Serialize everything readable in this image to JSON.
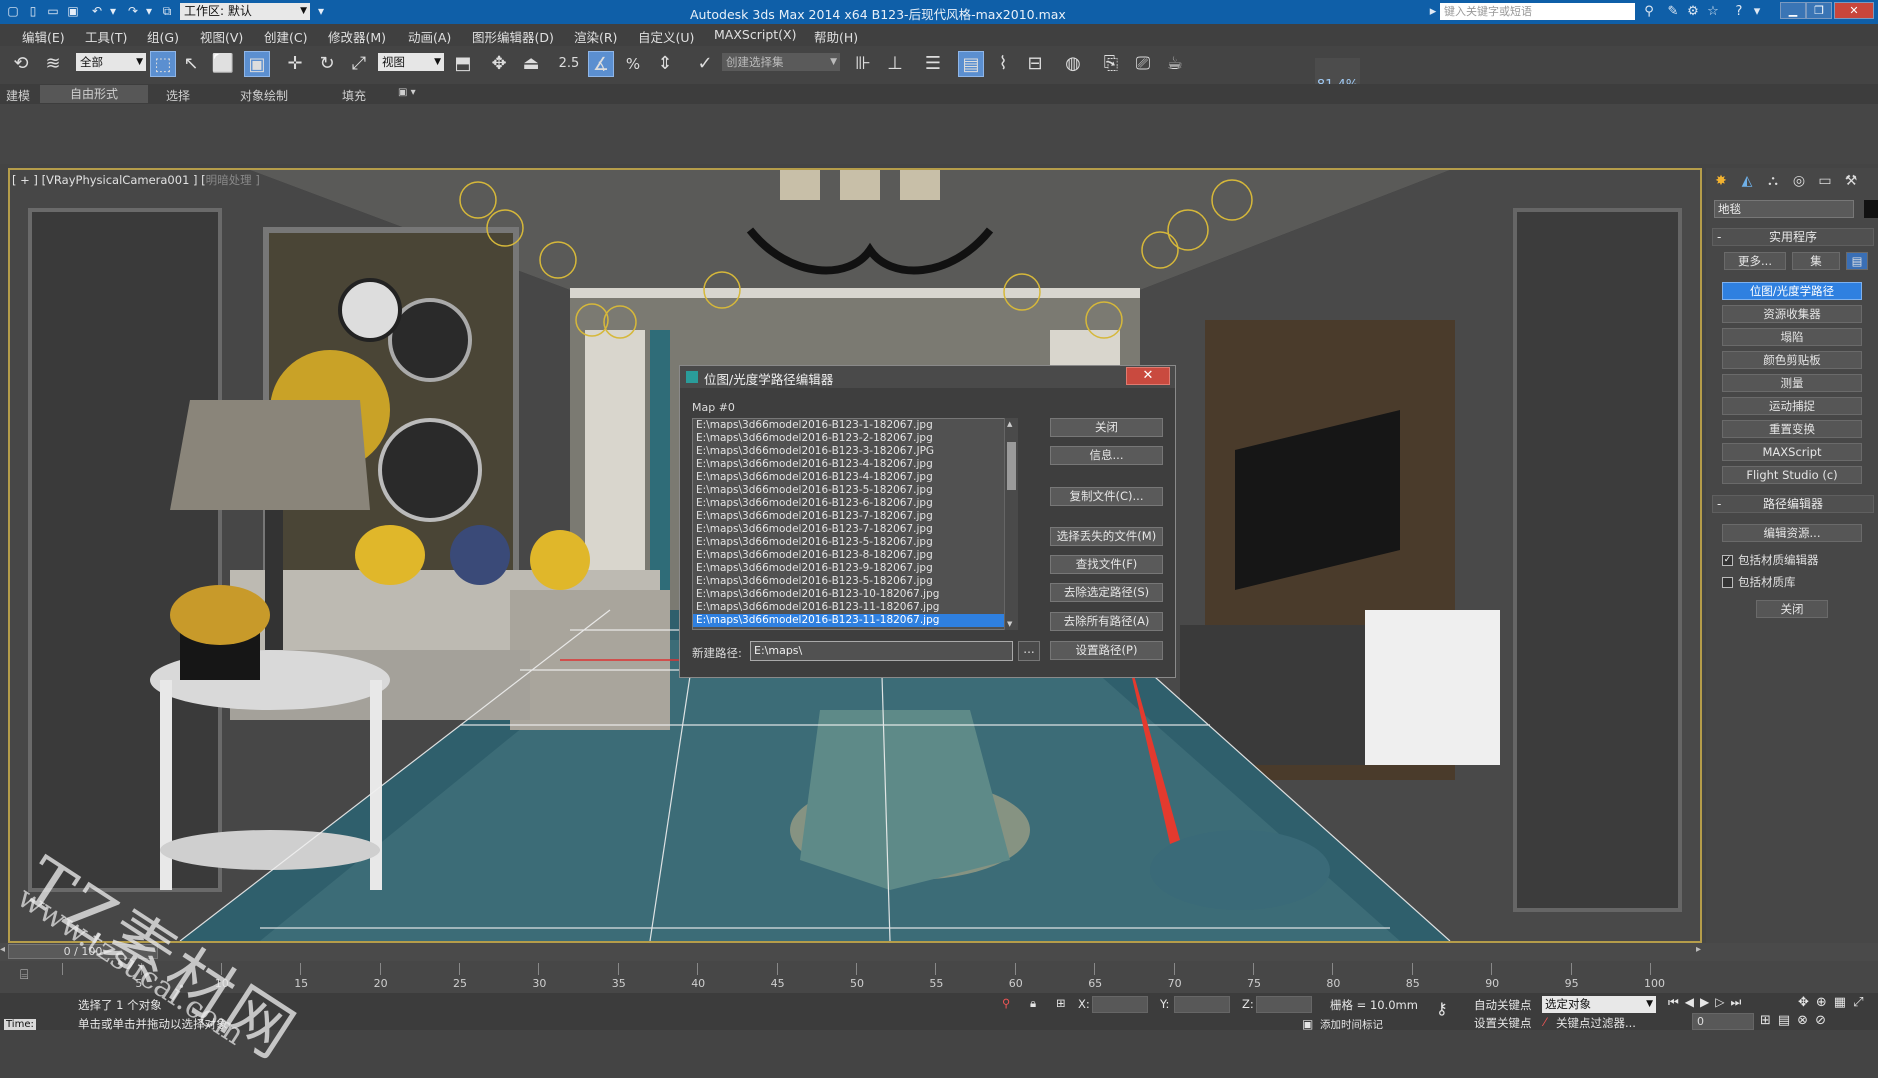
{
  "titlebar": {
    "workspace_label": "工作区: 默认",
    "app_title": "Autodesk 3ds Max  2014 x64      B123-后现代风格-max2010.max",
    "search_placeholder": "键入关键字或短语"
  },
  "menu": [
    "编辑(E)",
    "工具(T)",
    "组(G)",
    "视图(V)",
    "创建(C)",
    "修改器(M)",
    "动画(A)",
    "图形编辑器(D)",
    "渲染(R)",
    "自定义(U)",
    "MAXScript(X)",
    "帮助(H)"
  ],
  "toolbar": {
    "filter_select": "全部",
    "coord_select": "视图",
    "snap_value": "2.5",
    "selection_set": "创建选择集",
    "zoom_badge": "81.4%"
  },
  "ribbon_tabs": [
    "建模",
    "自由形式",
    "选择",
    "对象绘制",
    "填充"
  ],
  "viewport": {
    "label_main": "[ + ] [VRayPhysicalCamera001 ] [",
    "label_dim": "明暗处理 ]"
  },
  "dialog": {
    "title": "位图/光度学路径编辑器",
    "map_label": "Map #0",
    "files": [
      "E:\\maps\\3d66model2016-B123-1-182067.jpg",
      "E:\\maps\\3d66model2016-B123-2-182067.jpg",
      "E:\\maps\\3d66model2016-B123-3-182067.JPG",
      "E:\\maps\\3d66model2016-B123-4-182067.jpg",
      "E:\\maps\\3d66model2016-B123-4-182067.jpg",
      "E:\\maps\\3d66model2016-B123-5-182067.jpg",
      "E:\\maps\\3d66model2016-B123-6-182067.jpg",
      "E:\\maps\\3d66model2016-B123-7-182067.jpg",
      "E:\\maps\\3d66model2016-B123-7-182067.jpg",
      "E:\\maps\\3d66model2016-B123-5-182067.jpg",
      "E:\\maps\\3d66model2016-B123-8-182067.jpg",
      "E:\\maps\\3d66model2016-B123-9-182067.jpg",
      "E:\\maps\\3d66model2016-B123-5-182067.jpg",
      "E:\\maps\\3d66model2016-B123-10-182067.jpg",
      "E:\\maps\\3d66model2016-B123-11-182067.jpg",
      "E:\\maps\\3d66model2016-B123-11-182067.jpg"
    ],
    "selected_index": 15,
    "buttons": {
      "close": "关闭",
      "info": "信息...",
      "copy_files": "复制文件(C)...",
      "select_missing": "选择丢失的文件(M)",
      "find_files": "查找文件(F)",
      "strip_selected": "去除选定路径(S)",
      "strip_all": "去除所有路径(A)",
      "set_path": "设置路径(P)"
    },
    "new_path_label": "新建路径:",
    "new_path_value": "E:\\maps\\",
    "browse_label": "..."
  },
  "command_panel": {
    "object_name": "地毯",
    "utilities_title": "实用程序",
    "more_button": "更多...",
    "sets_button": "集",
    "utilities": [
      "位图/光度学路径",
      "资源收集器",
      "塌陷",
      "颜色剪贴板",
      "测量",
      "运动捕捉",
      "重置变换",
      "MAXScript",
      "Flight Studio (c)"
    ],
    "path_editor_title": "路径编辑器",
    "edit_resources": "编辑资源...",
    "include_material_editor": "包括材质编辑器",
    "include_material_library": "包括材质库",
    "close_button": "关闭"
  },
  "timeline": {
    "frame_display": "0 / 100",
    "ticks": [
      "5",
      "10",
      "15",
      "20",
      "25",
      "30",
      "35",
      "40",
      "45",
      "50",
      "55",
      "60",
      "65",
      "70",
      "75",
      "80",
      "85",
      "90",
      "95",
      "100"
    ]
  },
  "status": {
    "selection_text": "选择了 1 个对象",
    "prompt_text": "单击或单击并拖动以选择对象",
    "time_label": "Time:",
    "x_label": "X:",
    "y_label": "Y:",
    "z_label": "Z:",
    "grid_text": "栅格 = 10.0mm",
    "auto_key": "自动关键点",
    "set_key": "设置关键点",
    "key_mode_select": "选定对象",
    "key_filter": "关键点过滤器...",
    "add_time_tag": "添加时间标记",
    "frame_field": "0"
  },
  "watermark": {
    "line1": "TZ素材网",
    "line2": "www.tzsucai.com"
  }
}
